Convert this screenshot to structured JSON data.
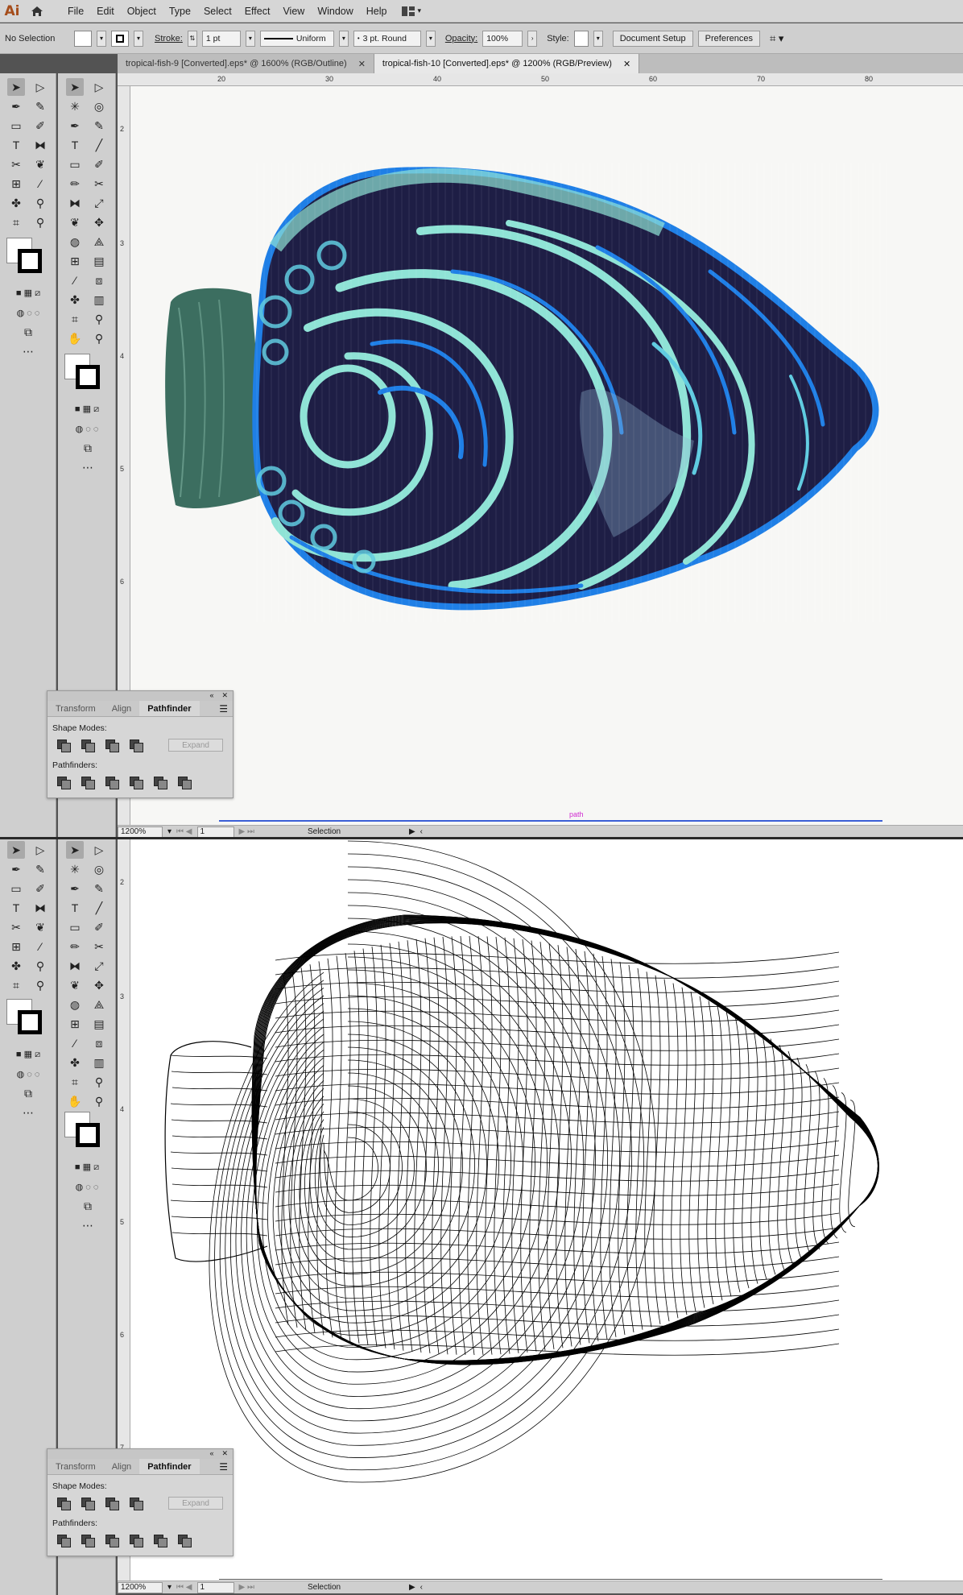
{
  "app": {
    "logo": "Ai"
  },
  "menu": [
    "File",
    "Edit",
    "Object",
    "Type",
    "Select",
    "Effect",
    "View",
    "Window",
    "Help"
  ],
  "control_bar": {
    "selection": "No Selection",
    "stroke_label": "Stroke:",
    "stroke_value": "1 pt",
    "stroke_profile": "Uniform",
    "brush": "3 pt. Round",
    "opacity_label": "Opacity:",
    "opacity_value": "100%",
    "style_label": "Style:",
    "document_setup": "Document Setup",
    "preferences": "Preferences"
  },
  "tabs": [
    {
      "label": "tropical-fish-9 [Converted].eps* @ 1600% (RGB/Outline)",
      "active": false
    },
    {
      "label": "tropical-fish-10 [Converted].eps* @ 1200% (RGB/Preview)",
      "active": true
    }
  ],
  "ruler": {
    "h": [
      "20",
      "30",
      "40",
      "50",
      "60",
      "70",
      "80"
    ],
    "v": [
      "2",
      "3",
      "4",
      "5",
      "6",
      "7"
    ]
  },
  "panel": {
    "tabs": [
      "Transform",
      "Align",
      "Pathfinder"
    ],
    "shape_modes": "Shape Modes:",
    "expand": "Expand",
    "pathfinders": "Pathfinders:"
  },
  "status": {
    "zoom": "1200%",
    "artboard": "1",
    "tool": "Selection"
  },
  "smart_guide": "path",
  "colors": {
    "fish_dark": "#1e1e45",
    "fish_cyan": "#8fe3d6",
    "fish_blue": "#1f7fe6",
    "tail": "#3c6e60"
  }
}
